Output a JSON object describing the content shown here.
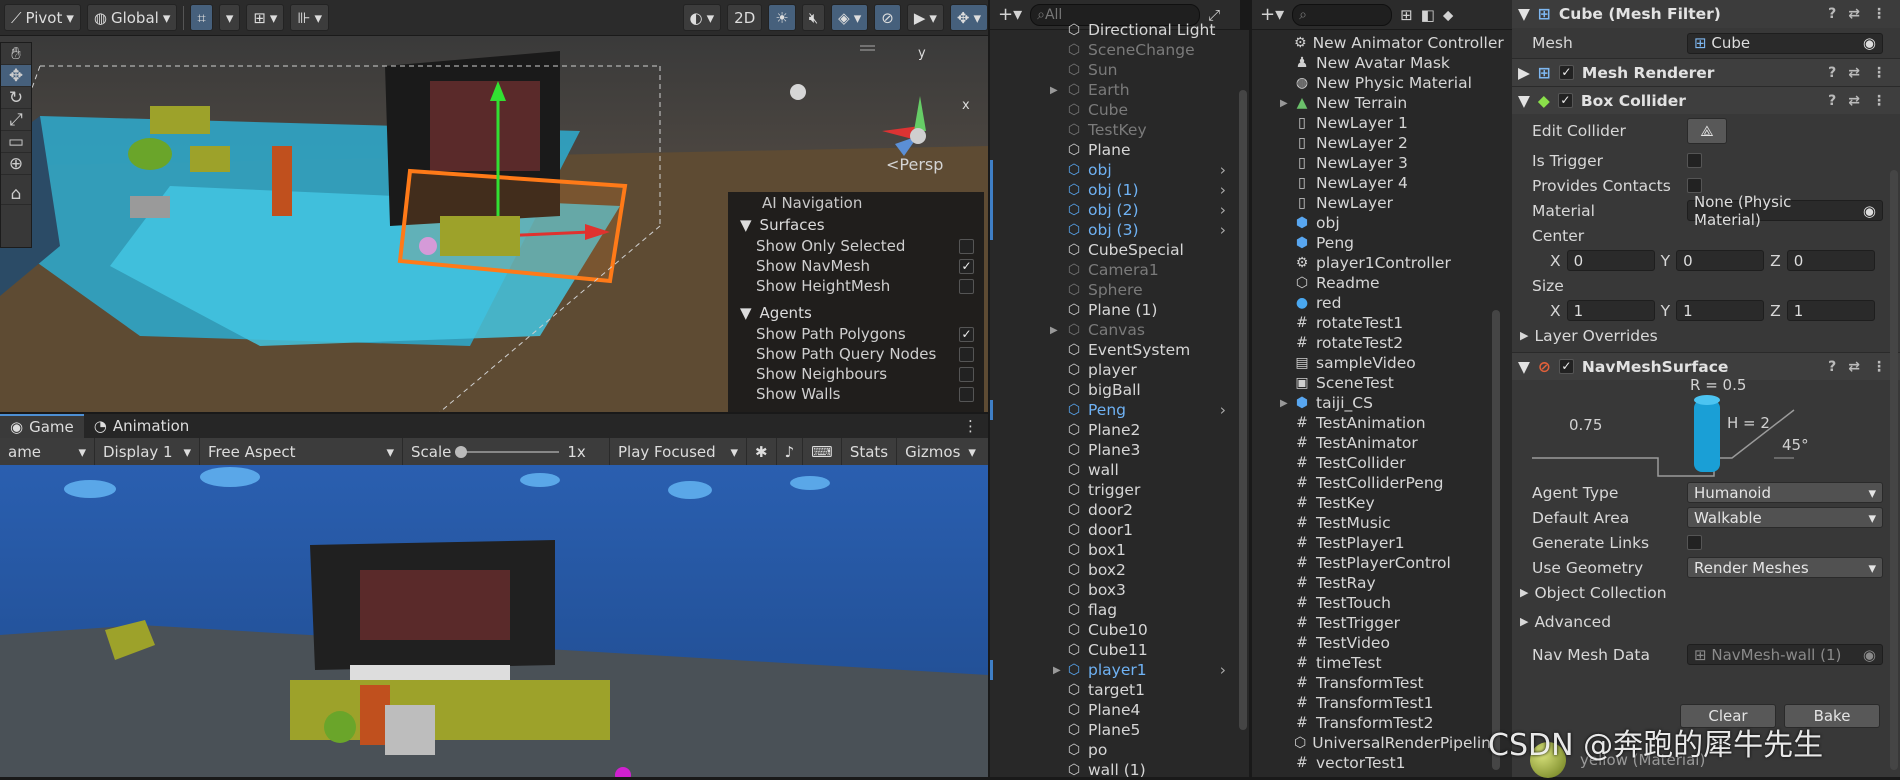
{
  "scene_toolbar": {
    "pivot": "Pivot",
    "global": "Global",
    "mode2d": "2D"
  },
  "scene_view": {
    "persp_label": "Persp",
    "gizmo_y": "y",
    "gizmo_x": "x"
  },
  "ai_nav": {
    "title": "AI Navigation",
    "surfaces_label": "Surfaces",
    "surfaces": [
      {
        "label": "Show Only Selected",
        "checked": false
      },
      {
        "label": "Show NavMesh",
        "checked": true
      },
      {
        "label": "Show HeightMesh",
        "checked": false
      }
    ],
    "agents_label": "Agents",
    "agents": [
      {
        "label": "Show Path Polygons",
        "checked": true
      },
      {
        "label": "Show Path Query Nodes",
        "checked": false
      },
      {
        "label": "Show Neighbours",
        "checked": false
      },
      {
        "label": "Show Walls",
        "checked": false
      }
    ]
  },
  "game_tabs": [
    {
      "label": "Game"
    },
    {
      "label": "Animation"
    }
  ],
  "game_toolbar": {
    "game": "ame",
    "display": "Display 1",
    "aspect": "Free Aspect",
    "scale_label": "Scale",
    "scale_value": "1x",
    "play": "Play Focused",
    "stats": "Stats",
    "gizmos": "Gizmos"
  },
  "hierarchy": {
    "search_placeholder": "All",
    "items": [
      {
        "label": "Directional Light",
        "dim": false,
        "blue": false,
        "arrow": false,
        "exp": false
      },
      {
        "label": "SceneChange",
        "dim": true,
        "blue": false,
        "arrow": false,
        "exp": false
      },
      {
        "label": "Sun",
        "dim": true,
        "blue": false,
        "arrow": false,
        "exp": false
      },
      {
        "label": "Earth",
        "dim": true,
        "blue": false,
        "arrow": false,
        "exp": true
      },
      {
        "label": "Cube",
        "dim": true,
        "blue": false,
        "arrow": false,
        "exp": false
      },
      {
        "label": "TestKey",
        "dim": true,
        "blue": false,
        "arrow": false,
        "exp": false
      },
      {
        "label": "Plane",
        "dim": false,
        "blue": false,
        "arrow": false,
        "exp": false
      },
      {
        "label": "obj",
        "dim": false,
        "blue": true,
        "arrow": true,
        "exp": false
      },
      {
        "label": "obj (1)",
        "dim": false,
        "blue": true,
        "arrow": true,
        "exp": false
      },
      {
        "label": "obj (2)",
        "dim": false,
        "blue": true,
        "arrow": true,
        "exp": false
      },
      {
        "label": "obj (3)",
        "dim": false,
        "blue": true,
        "arrow": true,
        "exp": false
      },
      {
        "label": "CubeSpecial",
        "dim": false,
        "blue": false,
        "arrow": false,
        "exp": false
      },
      {
        "label": "Camera1",
        "dim": true,
        "blue": false,
        "arrow": false,
        "exp": false
      },
      {
        "label": "Sphere",
        "dim": true,
        "blue": false,
        "arrow": false,
        "exp": false
      },
      {
        "label": "Plane (1)",
        "dim": false,
        "blue": false,
        "arrow": false,
        "exp": false
      },
      {
        "label": "Canvas",
        "dim": true,
        "blue": false,
        "arrow": false,
        "exp": true
      },
      {
        "label": "EventSystem",
        "dim": false,
        "blue": false,
        "arrow": false,
        "exp": false
      },
      {
        "label": "player",
        "dim": false,
        "blue": false,
        "arrow": false,
        "exp": false
      },
      {
        "label": "bigBall",
        "dim": false,
        "blue": false,
        "arrow": false,
        "exp": false
      },
      {
        "label": "Peng",
        "dim": false,
        "blue": true,
        "arrow": true,
        "exp": false
      },
      {
        "label": "Plane2",
        "dim": false,
        "blue": false,
        "arrow": false,
        "exp": false
      },
      {
        "label": "Plane3",
        "dim": false,
        "blue": false,
        "arrow": false,
        "exp": false
      },
      {
        "label": "wall",
        "dim": false,
        "blue": false,
        "arrow": false,
        "exp": false
      },
      {
        "label": "trigger",
        "dim": false,
        "blue": false,
        "arrow": false,
        "exp": false
      },
      {
        "label": "door2",
        "dim": false,
        "blue": false,
        "arrow": false,
        "exp": false
      },
      {
        "label": "door1",
        "dim": false,
        "blue": false,
        "arrow": false,
        "exp": false
      },
      {
        "label": "box1",
        "dim": false,
        "blue": false,
        "arrow": false,
        "exp": false
      },
      {
        "label": "box2",
        "dim": false,
        "blue": false,
        "arrow": false,
        "exp": false
      },
      {
        "label": "box3",
        "dim": false,
        "blue": false,
        "arrow": false,
        "exp": false
      },
      {
        "label": "flag",
        "dim": false,
        "blue": false,
        "arrow": false,
        "exp": false
      },
      {
        "label": "Cube10",
        "dim": false,
        "blue": false,
        "arrow": false,
        "exp": false
      },
      {
        "label": "Cube11",
        "dim": false,
        "blue": false,
        "arrow": false,
        "exp": false
      },
      {
        "label": "player1",
        "dim": false,
        "blue": true,
        "arrow": true,
        "exp": true
      },
      {
        "label": "target1",
        "dim": false,
        "blue": false,
        "arrow": false,
        "exp": false
      },
      {
        "label": "Plane4",
        "dim": false,
        "blue": false,
        "arrow": false,
        "exp": false
      },
      {
        "label": "Plane5",
        "dim": false,
        "blue": false,
        "arrow": false,
        "exp": false
      },
      {
        "label": "po",
        "dim": false,
        "blue": false,
        "arrow": false,
        "exp": false
      },
      {
        "label": "wall (1)",
        "dim": false,
        "blue": false,
        "arrow": false,
        "exp": false
      }
    ]
  },
  "project": {
    "items": [
      {
        "label": "New Animator Controller",
        "icon": "⚙",
        "exp": false
      },
      {
        "label": "New Avatar Mask",
        "icon": "♟",
        "exp": false
      },
      {
        "label": "New Physic Material",
        "icon": "◍",
        "exp": false
      },
      {
        "label": "New Terrain",
        "icon": "▲",
        "exp": true
      },
      {
        "label": "NewLayer 1",
        "icon": "▯",
        "exp": false
      },
      {
        "label": "NewLayer 2",
        "icon": "▯",
        "exp": false
      },
      {
        "label": "NewLayer 3",
        "icon": "▯",
        "exp": false
      },
      {
        "label": "NewLayer 4",
        "icon": "▯",
        "exp": false
      },
      {
        "label": "NewLayer",
        "icon": "▯",
        "exp": false
      },
      {
        "label": "obj",
        "icon": "⬢",
        "exp": false
      },
      {
        "label": "Peng",
        "icon": "⬢",
        "exp": false
      },
      {
        "label": "player1Controller",
        "icon": "⚙",
        "exp": false
      },
      {
        "label": "Readme",
        "icon": "⬡",
        "exp": false
      },
      {
        "label": "red",
        "icon": "●",
        "exp": false
      },
      {
        "label": "rotateTest1",
        "icon": "#",
        "exp": false
      },
      {
        "label": "rotateTest2",
        "icon": "#",
        "exp": false
      },
      {
        "label": "sampleVideo",
        "icon": "▤",
        "exp": false
      },
      {
        "label": "SceneTest",
        "icon": "▣",
        "exp": false
      },
      {
        "label": "taiji_CS",
        "icon": "⬢",
        "exp": true
      },
      {
        "label": "TestAnimation",
        "icon": "#",
        "exp": false
      },
      {
        "label": "TestAnimator",
        "icon": "#",
        "exp": false
      },
      {
        "label": "TestCollider",
        "icon": "#",
        "exp": false
      },
      {
        "label": "TestColliderPeng",
        "icon": "#",
        "exp": false
      },
      {
        "label": "TestKey",
        "icon": "#",
        "exp": false
      },
      {
        "label": "TestMusic",
        "icon": "#",
        "exp": false
      },
      {
        "label": "TestPlayer1",
        "icon": "#",
        "exp": false
      },
      {
        "label": "TestPlayerControl",
        "icon": "#",
        "exp": false
      },
      {
        "label": "TestRay",
        "icon": "#",
        "exp": false
      },
      {
        "label": "TestTouch",
        "icon": "#",
        "exp": false
      },
      {
        "label": "TestTrigger",
        "icon": "#",
        "exp": false
      },
      {
        "label": "TestVideo",
        "icon": "#",
        "exp": false
      },
      {
        "label": "timeTest",
        "icon": "#",
        "exp": false
      },
      {
        "label": "TransformTest",
        "icon": "#",
        "exp": false
      },
      {
        "label": "TransformTest1",
        "icon": "#",
        "exp": false
      },
      {
        "label": "TransformTest2",
        "icon": "#",
        "exp": false
      },
      {
        "label": "UniversalRenderPipeline",
        "icon": "⬡",
        "exp": false
      },
      {
        "label": "vectorTest1",
        "icon": "#",
        "exp": false
      }
    ]
  },
  "inspector": {
    "mesh_filter": {
      "title": "Cube (Mesh Filter)",
      "mesh_label": "Mesh",
      "mesh_value": "Cube"
    },
    "mesh_renderer": {
      "title": "Mesh Renderer"
    },
    "box_collider": {
      "title": "Box Collider",
      "edit_collider": "Edit Collider",
      "is_trigger": "Is Trigger",
      "provides_contacts": "Provides Contacts",
      "material_label": "Material",
      "material_value": "None (Physic Material)",
      "center_label": "Center",
      "center": {
        "x": "0",
        "y": "0",
        "z": "0"
      },
      "size_label": "Size",
      "size": {
        "x": "1",
        "y": "1",
        "z": "1"
      },
      "layer_overrides": "Layer Overrides"
    },
    "navmesh": {
      "title": "NavMeshSurface",
      "r_label": "R = 0.5",
      "h_label": "H = 2",
      "step_label": "0.75",
      "slope_label": "45°",
      "agent_type_label": "Agent Type",
      "agent_type": "Humanoid",
      "default_area_label": "Default Area",
      "default_area": "Walkable",
      "generate_links": "Generate Links",
      "use_geometry_label": "Use Geometry",
      "use_geometry": "Render Meshes",
      "object_collection": "Object Collection",
      "advanced": "Advanced",
      "nav_mesh_data_label": "Nav Mesh Data",
      "nav_mesh_data": "NavMesh-wall (1)",
      "clear": "Clear",
      "bake": "Bake",
      "material_peek": "yellow (Material)"
    }
  },
  "axis_labels": {
    "x": "X",
    "y": "Y",
    "z": "Z"
  },
  "watermark": "CSDN @奔跑的犀牛先生"
}
